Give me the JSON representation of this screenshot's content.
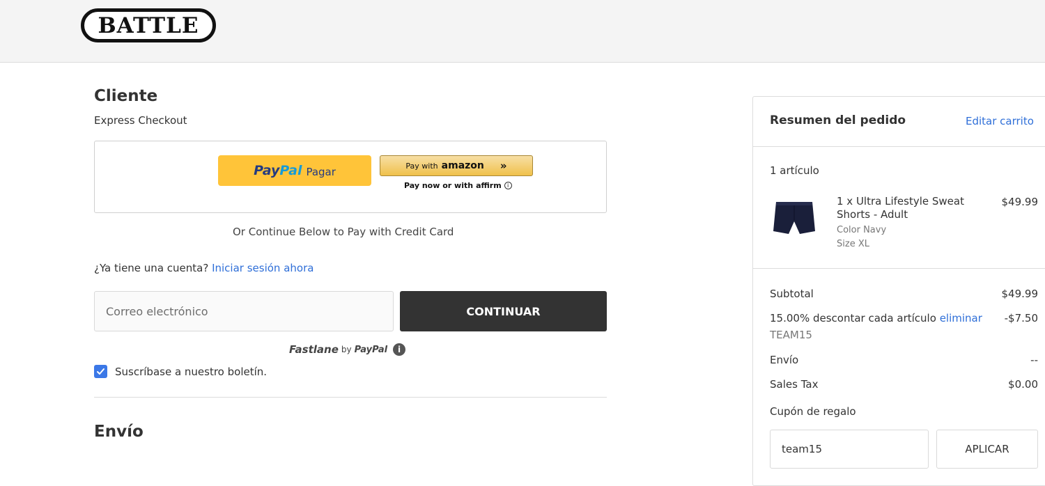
{
  "brand": {
    "logo_text": "BATTLE"
  },
  "customer": {
    "title": "Cliente",
    "express_label": "Express Checkout",
    "paypal": {
      "brand_pay": "Pay",
      "brand_pal": "Pal",
      "action": "Pagar"
    },
    "amazon": {
      "prefix": "Pay with",
      "brand": "amazon",
      "icon": "double-chevron-right-icon"
    },
    "affirm": {
      "text": "Pay now or with",
      "brand": "affirm"
    },
    "credit_card_note": "Or Continue Below to Pay with Credit Card",
    "account_question": "¿Ya tiene una cuenta?",
    "signin_link": "Iniciar sesión ahora",
    "email_placeholder": "Correo electrónico",
    "continue_label": "CONTINUAR",
    "fastlane": {
      "brand": "Fastlane",
      "by": "by",
      "paypal": "PayPal"
    },
    "newsletter": {
      "checked": true,
      "label": "Suscríbase a nuestro boletín."
    }
  },
  "shipping": {
    "title": "Envío"
  },
  "summary": {
    "title": "Resumen del pedido",
    "edit_link": "Editar carrito",
    "item_count": "1 artículo",
    "item": {
      "name_line1": "1 x Ultra Lifestyle Sweat",
      "name_line2": "Shorts - Adult",
      "color": "Color Navy",
      "size": "Size XL",
      "price": "$49.99"
    },
    "subtotal_label": "Subtotal",
    "subtotal_value": "$49.99",
    "discount_label": "15.00% descontar cada artículo",
    "discount_remove": "eliminar",
    "discount_value": "-$7.50",
    "discount_code": "TEAM15",
    "shipping_label": "Envío",
    "shipping_value": "--",
    "tax_label": "Sales Tax",
    "tax_value": "$0.00",
    "gift_coupon_label": "Cupón de regalo",
    "coupon_value": "team15",
    "apply_label": "APLICAR"
  },
  "colors": {
    "accent_link": "#2f6fd8",
    "paypal_yellow": "#ffc439",
    "dark_button": "#333333",
    "checkbox_blue": "#3b78e7",
    "product_navy": "#1a1f3a"
  }
}
